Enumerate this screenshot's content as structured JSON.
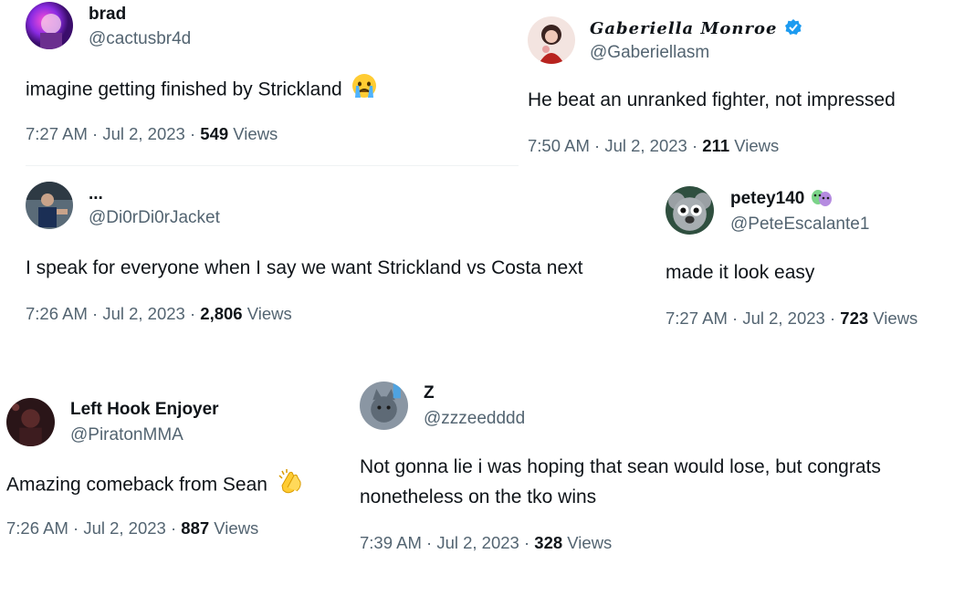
{
  "tweets": [
    {
      "name": "brad",
      "handle": "@cactusbr4d",
      "text": "imagine getting finished by Strickland",
      "time": "7:27 AM · Jul 2, 2023 · ",
      "views": "549",
      "views_label": " Views"
    },
    {
      "name": "Gaberiella Monroe",
      "handle": "@Gaberiellasm",
      "text": "He beat an unranked fighter, not impressed",
      "time": "7:50 AM · Jul 2, 2023 · ",
      "views": "211",
      "views_label": " Views"
    },
    {
      "name": "...",
      "handle": "@Di0rDi0rJacket",
      "text": "I speak for everyone when I say we want Strickland vs Costa next",
      "time": "7:26 AM · Jul 2, 2023 · ",
      "views": "2,806",
      "views_label": " Views"
    },
    {
      "name": "petey140",
      "handle": "@PeteEscalante1",
      "text": "made it look easy",
      "time": "7:27 AM · Jul 2, 2023 · ",
      "views": "723",
      "views_label": " Views"
    },
    {
      "name": "Left Hook Enjoyer",
      "handle": "@PiratonMMA",
      "text": "Amazing comeback from Sean",
      "time": "7:26 AM · Jul 2, 2023 · ",
      "views": "887",
      "views_label": " Views"
    },
    {
      "name": "Z",
      "handle": "@zzzeedddd",
      "text": "Not gonna lie i was hoping that sean would lose, but congrats nonetheless on the tko wins",
      "time": "7:39 AM · Jul 2, 2023 · ",
      "views": "328",
      "views_label": " Views"
    }
  ],
  "colors": {
    "text": "#0f1419",
    "secondary": "#536471",
    "verified": "#1d9bf0",
    "divider": "#eff3f4"
  },
  "icons": {
    "crying": "crying-face-emoji",
    "clap": "clapping-hands-emoji",
    "verified": "verified-badge-icon",
    "masks": "performing-arts-emoji"
  }
}
